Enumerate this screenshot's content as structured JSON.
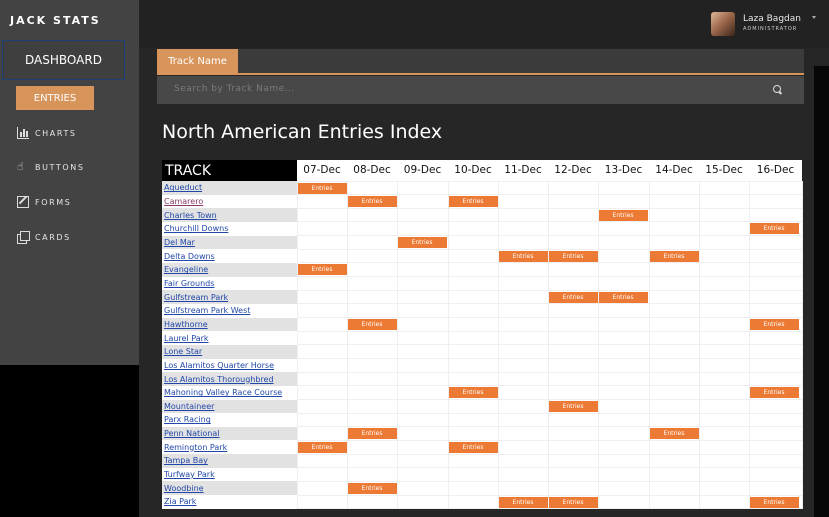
{
  "brand": "JACK STATS",
  "sidebar": {
    "dashboard_label": "DASHBOARD",
    "entries_label": "ENTRIES",
    "items": [
      {
        "label": "CHARTS",
        "icon": "bar-chart-icon"
      },
      {
        "label": "BUTTONS",
        "icon": "hand-pointer-icon"
      },
      {
        "label": "FORMS",
        "icon": "edit-icon"
      },
      {
        "label": "CARDS",
        "icon": "copy-icon"
      }
    ]
  },
  "user": {
    "name": "Laza Bagdan",
    "role": "ADMINISTRATOR"
  },
  "tab": {
    "label": "Track Name"
  },
  "search": {
    "placeholder": "Search by  Track Name..."
  },
  "page_title": "North American Entries Index",
  "table": {
    "track_header": "TRACK",
    "dates": [
      "07-Dec",
      "08-Dec",
      "09-Dec",
      "10-Dec",
      "11-Dec",
      "12-Dec",
      "13-Dec",
      "14-Dec",
      "15-Dec",
      "16-Dec"
    ],
    "entry_label": "Entries",
    "rows": [
      {
        "track": "Aqueduct",
        "entries": [
          0
        ]
      },
      {
        "track": "Camarero",
        "entries": [
          1,
          3
        ],
        "visited": true
      },
      {
        "track": "Charles Town",
        "entries": [
          6
        ]
      },
      {
        "track": "Churchill Downs",
        "entries": [
          9
        ]
      },
      {
        "track": "Del Mar",
        "entries": [
          2
        ]
      },
      {
        "track": "Delta Downs",
        "entries": [
          4,
          5,
          7
        ]
      },
      {
        "track": "Evangeline",
        "entries": [
          0
        ]
      },
      {
        "track": "Fair Grounds",
        "entries": []
      },
      {
        "track": "Gulfstream Park",
        "entries": [
          5,
          6
        ]
      },
      {
        "track": "Gulfstream Park West",
        "entries": []
      },
      {
        "track": "Hawthorne",
        "entries": [
          1,
          9
        ]
      },
      {
        "track": "Laurel Park",
        "entries": []
      },
      {
        "track": "Lone Star",
        "entries": []
      },
      {
        "track": "Los Alamitos Quarter Horse",
        "entries": []
      },
      {
        "track": "Los Alamitos Thoroughbred",
        "entries": []
      },
      {
        "track": "Mahoning Valley Race Course",
        "entries": [
          3,
          9
        ]
      },
      {
        "track": "Mountaineer",
        "entries": [
          5
        ]
      },
      {
        "track": "Parx Racing",
        "entries": []
      },
      {
        "track": "Penn National",
        "entries": [
          1,
          7
        ]
      },
      {
        "track": "Remington Park",
        "entries": [
          0,
          3
        ]
      },
      {
        "track": "Tampa Bay",
        "entries": []
      },
      {
        "track": "Turfway Park",
        "entries": []
      },
      {
        "track": "Woodbine",
        "entries": [
          1
        ]
      },
      {
        "track": "Zia Park",
        "entries": [
          4,
          5,
          9
        ]
      }
    ]
  },
  "colors": {
    "accent": "#d7955b",
    "entry": "#ec7a34",
    "link": "#2147a8"
  }
}
